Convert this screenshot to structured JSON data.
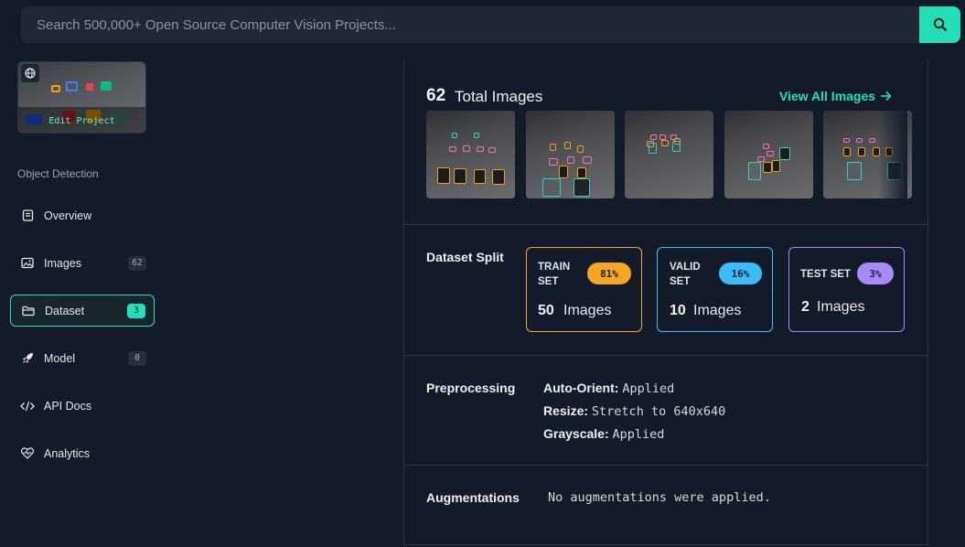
{
  "search": {
    "placeholder": "Search 500,000+ Open Source Computer Vision Projects...",
    "icon": "search-icon"
  },
  "sidebar": {
    "thumbnail": {
      "edit_label": "Edit Project",
      "icon": "globe-icon"
    },
    "section_label": "Object Detection",
    "items": [
      {
        "label": "Overview",
        "icon": "document-icon",
        "count": null,
        "active": false
      },
      {
        "label": "Images",
        "icon": "image-icon",
        "count": "62",
        "active": false
      },
      {
        "label": "Dataset",
        "icon": "folder-icon",
        "count": "3",
        "active": true
      },
      {
        "label": "Model",
        "icon": "rocket-icon",
        "count": "0",
        "active": false
      },
      {
        "label": "API Docs",
        "icon": "code-icon",
        "count": null,
        "active": false
      },
      {
        "label": "Analytics",
        "icon": "heart-pulse-icon",
        "count": null,
        "active": false
      }
    ]
  },
  "main": {
    "total_images": {
      "count": "62",
      "label": "Total Images"
    },
    "view_all": "View All Images",
    "dataset_split": {
      "label": "Dataset Split",
      "cards": [
        {
          "name_line1": "TRAIN",
          "name_line2": "SET",
          "percent": "81%",
          "count": "50",
          "unit": "Images",
          "color": "#f5a623"
        },
        {
          "name_line1": "VALID",
          "name_line2": "SET",
          "percent": "16%",
          "count": "10",
          "unit": "Images",
          "color": "#38bdf8"
        },
        {
          "name_line1": "TEST SET",
          "name_line2": "",
          "percent": "3%",
          "count": "2",
          "unit": "Images",
          "color": "#a78bfa"
        }
      ]
    },
    "preprocessing": {
      "label": "Preprocessing",
      "items": [
        {
          "key": "Auto-Orient:",
          "value": "Applied"
        },
        {
          "key": "Resize:",
          "value": "Stretch to 640x640"
        },
        {
          "key": "Grayscale:",
          "value": "Applied"
        }
      ]
    },
    "augmentations": {
      "label": "Augmentations",
      "text": "No augmentations were applied."
    }
  },
  "colors": {
    "accent": "#22dfb8",
    "background": "#131b2b",
    "train": "#f5a623",
    "valid": "#38bdf8",
    "test": "#a78bfa"
  }
}
